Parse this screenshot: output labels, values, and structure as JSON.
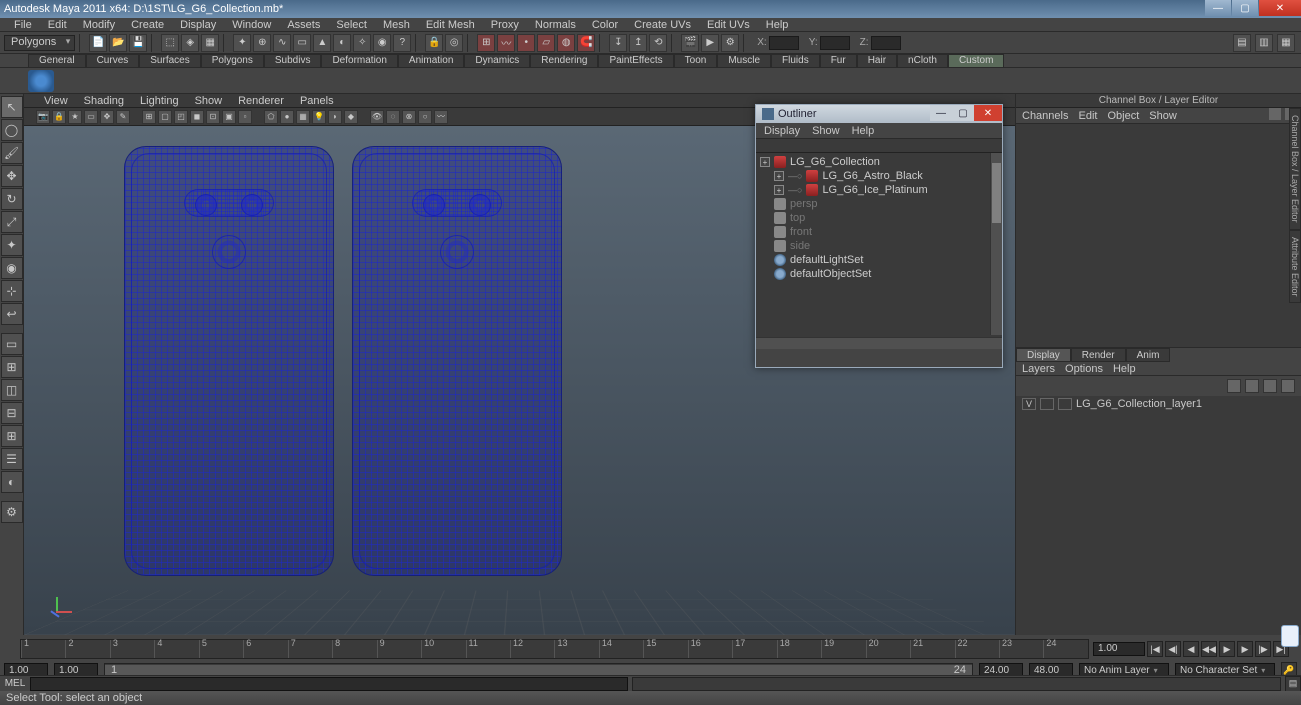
{
  "window": {
    "title": "Autodesk Maya 2011 x64: D:\\1ST\\LG_G6_Collection.mb*"
  },
  "menubar": [
    "File",
    "Edit",
    "Modify",
    "Create",
    "Display",
    "Window",
    "Assets",
    "Select",
    "Mesh",
    "Edit Mesh",
    "Proxy",
    "Normals",
    "Color",
    "Create UVs",
    "Edit UVs",
    "Help"
  ],
  "status": {
    "mode_dropdown": "Polygons",
    "coords": {
      "x_label": "X:",
      "y_label": "Y:",
      "z_label": "Z:"
    }
  },
  "shelf_tabs": [
    "General",
    "Curves",
    "Surfaces",
    "Polygons",
    "Subdivs",
    "Deformation",
    "Animation",
    "Dynamics",
    "Rendering",
    "PaintEffects",
    "Toon",
    "Muscle",
    "Fluids",
    "Fur",
    "Hair",
    "nCloth",
    "Custom"
  ],
  "shelf_active": "Custom",
  "viewport_menus": [
    "View",
    "Shading",
    "Lighting",
    "Show",
    "Renderer",
    "Panels"
  ],
  "outliner": {
    "title": "Outliner",
    "menus": [
      "Display",
      "Show",
      "Help"
    ],
    "items": [
      {
        "exp": "+",
        "type": "grp",
        "label": "LG_G6_Collection",
        "indent": 0
      },
      {
        "exp": "+",
        "type": "grp",
        "label": "LG_G6_Astro_Black",
        "indent": 1,
        "conn": true
      },
      {
        "exp": "+",
        "type": "grp",
        "label": "LG_G6_Ice_Platinum",
        "indent": 1,
        "conn": true
      },
      {
        "exp": "",
        "type": "cam",
        "label": "persp",
        "indent": 0,
        "dim": true
      },
      {
        "exp": "",
        "type": "cam",
        "label": "top",
        "indent": 0,
        "dim": true
      },
      {
        "exp": "",
        "type": "cam",
        "label": "front",
        "indent": 0,
        "dim": true
      },
      {
        "exp": "",
        "type": "cam",
        "label": "side",
        "indent": 0,
        "dim": true
      },
      {
        "exp": "",
        "type": "set",
        "label": "defaultLightSet",
        "indent": 0
      },
      {
        "exp": "",
        "type": "set",
        "label": "defaultObjectSet",
        "indent": 0
      }
    ]
  },
  "channel_box": {
    "title": "Channel Box / Layer Editor",
    "menus": [
      "Channels",
      "Edit",
      "Object",
      "Show"
    ],
    "tabs": [
      "Display",
      "Render",
      "Anim"
    ],
    "tab_active": "Display",
    "sub_menus": [
      "Layers",
      "Options",
      "Help"
    ],
    "layer": {
      "vis": "V",
      "name": "LG_G6_Collection_layer1"
    },
    "side_tabs": [
      "Channel Box / Layer Editor",
      "Attribute Editor"
    ]
  },
  "timeline": {
    "start_outer": "1.00",
    "start_inner": "1.00",
    "end_inner": "24.00",
    "end_outer": "48.00",
    "current": "1.00",
    "ticks": [
      "1",
      "2",
      "3",
      "4",
      "5",
      "6",
      "7",
      "8",
      "9",
      "10",
      "11",
      "12",
      "13",
      "14",
      "15",
      "16",
      "17",
      "18",
      "19",
      "20",
      "21",
      "22",
      "23",
      "24"
    ],
    "range_slider_label_left": "1",
    "range_slider_label_right": "24",
    "anim_layer": "No Anim Layer",
    "char_set": "No Character Set"
  },
  "command": {
    "label": "MEL"
  },
  "helpline": "Select Tool: select an object"
}
